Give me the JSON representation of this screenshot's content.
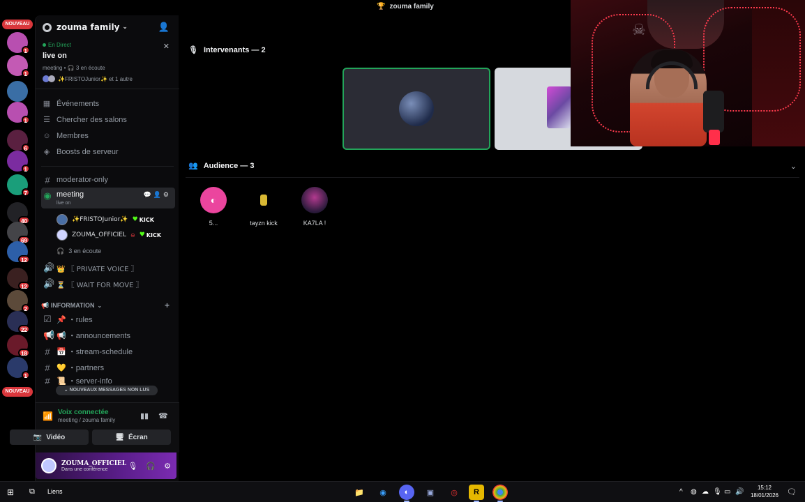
{
  "window": {
    "title": "zouma family",
    "title_icon": "trophy-icon"
  },
  "rail": {
    "nouveau_top": "NOUVEAU",
    "nouveau_bottom": "NOUVEAU",
    "servers": [
      {
        "badge": "1",
        "color": "#b84fb0"
      },
      {
        "badge": "1",
        "color": "#c35ab4"
      },
      {
        "badge": "",
        "color": "#3a6ea5"
      },
      {
        "badge": "1",
        "color": "#b84fb0"
      },
      {
        "badge": "6",
        "color": "#5a2040"
      },
      {
        "badge": "1",
        "color": "#7b2ca0"
      },
      {
        "badge": "7",
        "color": "#1a9e7a"
      },
      {
        "badge": "40",
        "color": "#222226"
      },
      {
        "badge": "69",
        "color": "#444448"
      },
      {
        "badge": "12",
        "color": "#2d5fa8"
      },
      {
        "badge": "12",
        "color": "#3a2020"
      },
      {
        "badge": "2",
        "color": "#5c4a3a"
      },
      {
        "badge": "22",
        "color": "#2a2f55"
      },
      {
        "badge": "18",
        "color": "#6a1a2a"
      },
      {
        "badge": "1",
        "color": "#2a3a6a"
      }
    ]
  },
  "server": {
    "name": "zouma family"
  },
  "live": {
    "tag": "En Direct",
    "title": "live on",
    "sub": "meeting • 🎧 3 en écoute",
    "users": "✨FRISTOJunior✨ et 1 autre"
  },
  "menu": [
    {
      "label": "Événements",
      "icon": "calendar-icon"
    },
    {
      "label": "Chercher des salons",
      "icon": "search-icon"
    },
    {
      "label": "Membres",
      "icon": "members-icon"
    },
    {
      "label": "Boosts de serveur",
      "icon": "boost-icon"
    }
  ],
  "channels": {
    "moderator": "moderator-only",
    "meeting": {
      "name": "meeting",
      "sub": "live on"
    },
    "voice_users": [
      {
        "name": "✨FRISTOJunior✨",
        "kick": "KICK"
      },
      {
        "name": "ZOUMA_OFFICIEL",
        "kick": "KICK"
      }
    ],
    "listening": "3 en écoute",
    "private_voice": "👑 〖 PRIVATE VOICE 〗",
    "wait_move": "⏳ 〖 WAIT FOR MOVE 〗",
    "category": "📢 INFORMATION",
    "info": [
      {
        "name": "📌 ・rules",
        "icon": "rules-icon"
      },
      {
        "name": "📢 ・announcements",
        "icon": "megaphone-icon"
      },
      {
        "name": "📅 ・stream-schedule",
        "icon": "hash-icon"
      },
      {
        "name": "💛 ・partners",
        "icon": "hash-icon"
      },
      {
        "name": "📜 ・server-info",
        "icon": "hash-icon"
      }
    ],
    "unread": "NOUVEAUX MESSAGES NON LUS"
  },
  "voice": {
    "status": "Voix connectée",
    "location": "meeting / zouma family",
    "video": "Vidéo",
    "screen": "Écran"
  },
  "user": {
    "name": "ZOUMA_OFFICIEL",
    "status": "Dans une conférence"
  },
  "stage": {
    "speakers": "Intervenants — 2",
    "audience": "Audience — 3",
    "audience_members": [
      {
        "name": "5..."
      },
      {
        "name": "tayzn kick"
      },
      {
        "name": "KA7LA !"
      }
    ]
  },
  "taskbar": {
    "links": "Liens",
    "time": "15:12",
    "date": "18/01/2026"
  }
}
